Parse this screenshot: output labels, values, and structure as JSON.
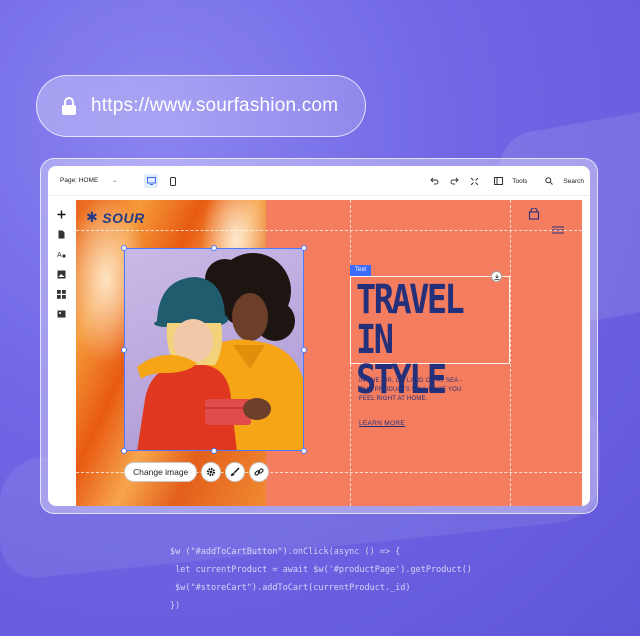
{
  "browser": {
    "url": "https://www.sourfashion.com"
  },
  "editor": {
    "topbar": {
      "page_label": "Page: HOME",
      "tools_label": "Tools",
      "search_label": "Search"
    },
    "site": {
      "logo_text": "SOUR",
      "headline_line1": "TRAVEL",
      "headline_line2": "IN STYLE",
      "subcopy_line1": "IN THE AIR, ON LAND OR AT SEA -",
      "subcopy_line2": "OUR PRODUCTS WILL MAKE YOU",
      "subcopy_line3": "FEEL RIGHT AT HOME.",
      "learn_more": "LEARN MORE",
      "text_tag": "Text"
    },
    "image_toolbar": {
      "change_image": "Change image"
    }
  },
  "code": {
    "line1": "$w (\"#addToCartButton\").onClick(async () => {",
    "line2": " let currentProduct = await $w('#productPage').getProduct()",
    "line3": " $w(\"#storeCart\").addToCart(currentProduct._id)",
    "line4": "})"
  }
}
